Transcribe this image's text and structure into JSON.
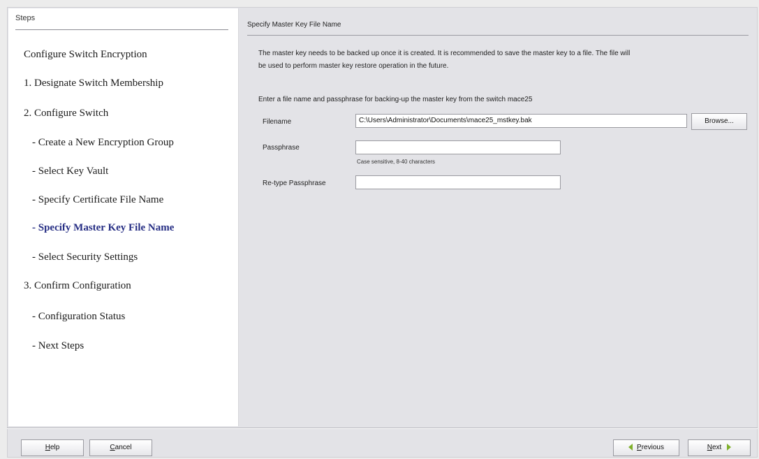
{
  "steps": {
    "header": "Steps",
    "items": [
      {
        "label": "Configure Switch Encryption",
        "current": false
      },
      {
        "label": "1. Designate Switch Membership",
        "current": false
      },
      {
        "label": "2. Configure Switch",
        "current": false
      },
      {
        "label": "- Create a New Encryption Group",
        "current": false
      },
      {
        "label": "- Select Key Vault",
        "current": false
      },
      {
        "label": "- Specify Certificate File Name",
        "current": false
      },
      {
        "label": "- Specify Master Key File Name",
        "current": true
      },
      {
        "label": "- Select Security Settings",
        "current": false
      },
      {
        "label": "3. Confirm Configuration",
        "current": false
      },
      {
        "label": "- Configuration Status",
        "current": false
      },
      {
        "label": "- Next Steps",
        "current": false
      }
    ]
  },
  "content": {
    "title": "Specify Master Key File Name",
    "description_line1": "The master key needs to be backed up once it is created. It is recommended to save the master key to a file. The file will",
    "description_line2": "be used to perform master key restore operation in the future.",
    "instruction": "Enter a file name and passphrase for backing-up the master key from the switch mace25",
    "filename_label": "Filename",
    "filename_value": "C:\\Users\\Administrator\\Documents\\mace25_mstkey.bak",
    "browse_label": "Browse...",
    "passphrase_label": "Passphrase",
    "passphrase_value": "",
    "passphrase_hint": "Case sensitive, 8-40 characters",
    "retype_label": "Re-type Passphrase",
    "retype_value": ""
  },
  "footer": {
    "help_prefix": "H",
    "help_rest": "elp",
    "cancel_prefix": "C",
    "cancel_rest": "ancel",
    "previous_prefix": "P",
    "previous_rest": "revious",
    "next_prefix": "N",
    "next_rest": "ext"
  },
  "colors": {
    "current_step": "#262e84",
    "nav_arrow": "#7fb02a"
  },
  "icons": {
    "previous": "arrow-left-icon",
    "next": "arrow-right-icon"
  }
}
